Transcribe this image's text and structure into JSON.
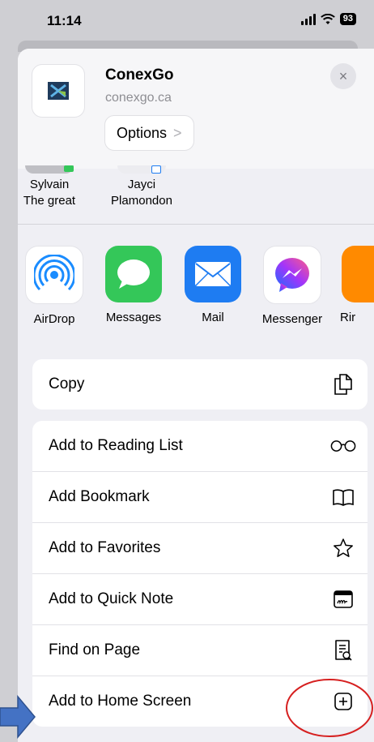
{
  "status_bar": {
    "time": "11:14",
    "battery": "93"
  },
  "header": {
    "app_name": "ConexGo",
    "url": "conexgo.ca",
    "options_label": "Options",
    "options_chevron": ">",
    "close_symbol": "×"
  },
  "people": [
    {
      "line1": "Sylvain",
      "line2": "The great"
    },
    {
      "line1": "Jayci",
      "line2": "Plamondon"
    }
  ],
  "apps": [
    {
      "label": "AirDrop",
      "icon": "airdrop-icon",
      "color": "#1a8cff"
    },
    {
      "label": "Messages",
      "icon": "messages-icon",
      "color": "#34c759"
    },
    {
      "label": "Mail",
      "icon": "mail-icon",
      "color": "#1e7cf2"
    },
    {
      "label": "Messenger",
      "icon": "messenger-icon",
      "color": "#a334fa"
    },
    {
      "label": "Rir",
      "icon": "partial-app-icon",
      "color": "#ff8a00"
    }
  ],
  "actions_primary": [
    {
      "label": "Copy",
      "icon": "copy-icon"
    }
  ],
  "actions_secondary": [
    {
      "label": "Add to Reading List",
      "icon": "reading-glasses-icon"
    },
    {
      "label": "Add Bookmark",
      "icon": "bookmark-book-icon"
    },
    {
      "label": "Add to Favorites",
      "icon": "star-icon"
    },
    {
      "label": "Add to Quick Note",
      "icon": "quick-note-icon"
    },
    {
      "label": "Find on Page",
      "icon": "find-document-icon"
    },
    {
      "label": "Add to Home Screen",
      "icon": "plus-square-icon"
    }
  ],
  "annotation_colors": {
    "arrow": "#4472c4",
    "circle": "#d62020"
  }
}
